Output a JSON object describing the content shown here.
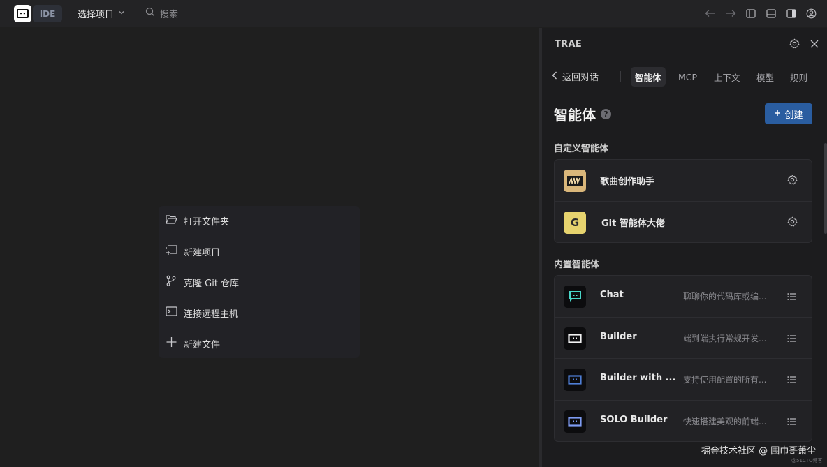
{
  "topbar": {
    "ide_label": "IDE",
    "project_select": "选择项目",
    "search_placeholder": "搜索"
  },
  "start_menu": {
    "items": [
      {
        "label": "打开文件夹",
        "icon": "folder-open-icon"
      },
      {
        "label": "新建项目",
        "icon": "new-project-icon"
      },
      {
        "label": "克隆 Git 仓库",
        "icon": "git-branch-icon"
      },
      {
        "label": "连接远程主机",
        "icon": "terminal-icon"
      },
      {
        "label": "新建文件",
        "icon": "plus-icon"
      }
    ]
  },
  "panel": {
    "title": "TRAE",
    "back_label": "返回对话",
    "tabs": [
      {
        "label": "智能体",
        "active": true
      },
      {
        "label": "MCP",
        "active": false
      },
      {
        "label": "上下文",
        "active": false
      },
      {
        "label": "模型",
        "active": false
      },
      {
        "label": "规则",
        "active": false
      }
    ],
    "heading": "智能体",
    "help_glyph": "?",
    "create_label": "创建",
    "custom_group_label": "自定义智能体",
    "custom_agents": [
      {
        "name": "歌曲创作助手",
        "avatar_text": "",
        "avatar_icon": "music-wave-icon"
      },
      {
        "name": "Git 智能体大佬",
        "avatar_text": "G",
        "avatar_icon": "letter-g-avatar"
      }
    ],
    "builtin_group_label": "内置智能体",
    "builtin_agents": [
      {
        "name": "Chat",
        "desc": "聊聊你的代码库或编..."
      },
      {
        "name": "Builder",
        "desc": "端到端执行常规开发..."
      },
      {
        "name": "Builder with ...",
        "desc": "支持使用配置的所有..."
      },
      {
        "name": "SOLO Builder",
        "desc": "快速搭建美观的前端..."
      }
    ]
  },
  "watermark": {
    "text": "掘金技术社区 @ 围巾哥萧尘",
    "small": "@51CTO博客"
  },
  "colors": {
    "accent": "#2a5da0",
    "background": "#1f1f1f",
    "panel": "#1c1c1e"
  }
}
